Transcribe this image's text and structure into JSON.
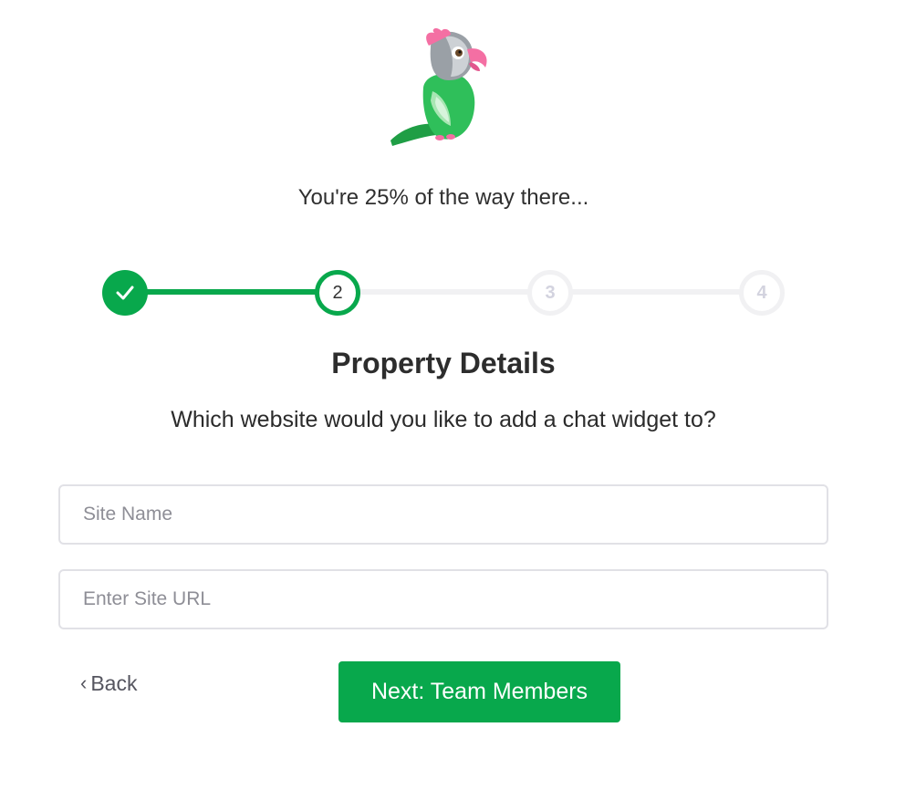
{
  "logo": {
    "icon": "parrot-mascot-icon"
  },
  "progress": {
    "text": "You're 25% of the way there...",
    "percent": 25,
    "current_step": 2,
    "steps": [
      {
        "label": "",
        "state": "done",
        "icon": "check-icon"
      },
      {
        "label": "2",
        "state": "current"
      },
      {
        "label": "3",
        "state": "upcoming"
      },
      {
        "label": "4",
        "state": "upcoming"
      }
    ]
  },
  "form": {
    "title": "Property Details",
    "subtitle": "Which website would you like to add a chat widget to?",
    "site_name": {
      "value": "",
      "placeholder": "Site Name"
    },
    "site_url": {
      "value": "",
      "placeholder": "Enter Site URL"
    }
  },
  "actions": {
    "back_label": "Back",
    "back_icon": "chevron-left-icon",
    "next_label": "Next: Team Members"
  },
  "colors": {
    "accent": "#08a84c",
    "track_inactive": "#f1f1f3",
    "inactive_step_text": "#d3d3df"
  }
}
